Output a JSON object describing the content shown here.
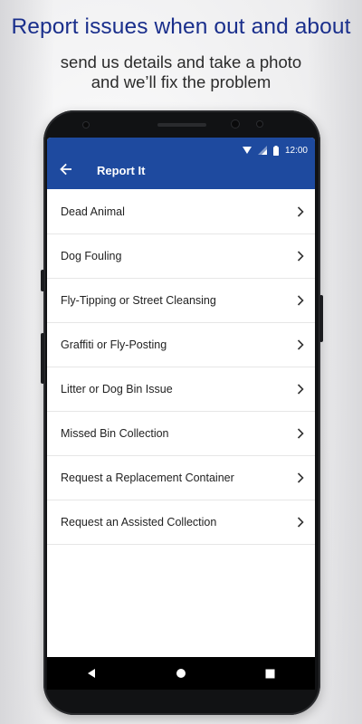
{
  "promo": {
    "headline": "Report issues when out and about",
    "subline_1": "send us details and take a photo",
    "subline_2": "and we’ll fix the problem"
  },
  "status_bar": {
    "time": "12:00"
  },
  "app_bar": {
    "title": "Report It",
    "color": "#1e4a9f"
  },
  "list": {
    "items": [
      {
        "label": "Dead Animal"
      },
      {
        "label": "Dog Fouling"
      },
      {
        "label": "Fly-Tipping or Street Cleansing"
      },
      {
        "label": "Graffiti or Fly-Posting"
      },
      {
        "label": "Litter or Dog Bin Issue"
      },
      {
        "label": "Missed Bin Collection"
      },
      {
        "label": "Request a Replacement Container"
      },
      {
        "label": "Request an Assisted Collection"
      }
    ]
  },
  "icons": {
    "back": "arrow-left-icon",
    "row": "chevron-right-icon",
    "wifi": "wifi-icon",
    "signal": "signal-icon",
    "battery": "battery-icon",
    "nav_back": "triangle-back-icon",
    "nav_home": "circle-home-icon",
    "nav_recents": "square-recents-icon"
  }
}
